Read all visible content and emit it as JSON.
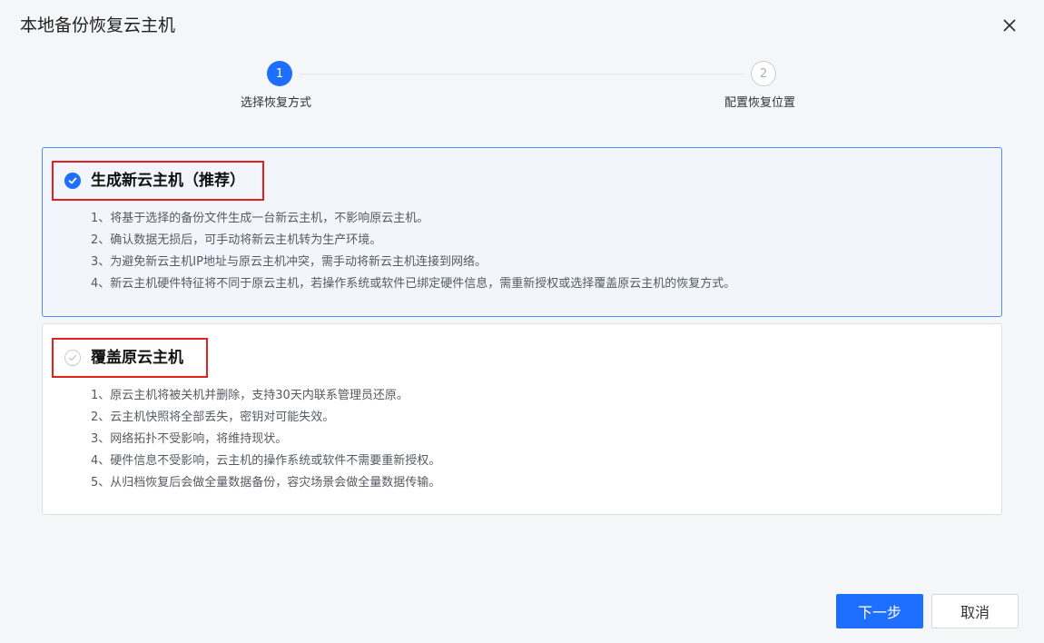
{
  "dialog": {
    "title": "本地备份恢复云主机",
    "close_icon": "close-icon"
  },
  "steps": [
    {
      "number": "1",
      "label": "选择恢复方式",
      "state": "active"
    },
    {
      "number": "2",
      "label": "配置恢复位置",
      "state": "inactive"
    }
  ],
  "options": [
    {
      "title": "生成新云主机（推荐）",
      "selected": true,
      "items": [
        "1、将基于选择的备份文件生成一台新云主机，不影响原云主机。",
        "2、确认数据无损后，可手动将新云主机转为生产环境。",
        "3、为避免新云主机IP地址与原云主机冲突，需手动将新云主机连接到网络。",
        "4、新云主机硬件特征将不同于原云主机，若操作系统或软件已绑定硬件信息，需重新授权或选择覆盖原云主机的恢复方式。"
      ]
    },
    {
      "title": "覆盖原云主机",
      "selected": false,
      "items": [
        "1、原云主机将被关机并删除，支持30天内联系管理员还原。",
        "2、云主机快照将全部丢失，密钥对可能失效。",
        "3、网络拓扑不受影响，将维持现状。",
        "4、硬件信息不受影响，云主机的操作系统或软件不需要重新授权。",
        "5、从归档恢复后会做全量数据备份，容灾场景会做全量数据传输。"
      ]
    }
  ],
  "footer": {
    "next_label": "下一步",
    "cancel_label": "取消"
  },
  "colors": {
    "primary": "#1e6fff",
    "highlight_border": "#e3201b",
    "selected_card_bg": "#f2f6fc"
  }
}
